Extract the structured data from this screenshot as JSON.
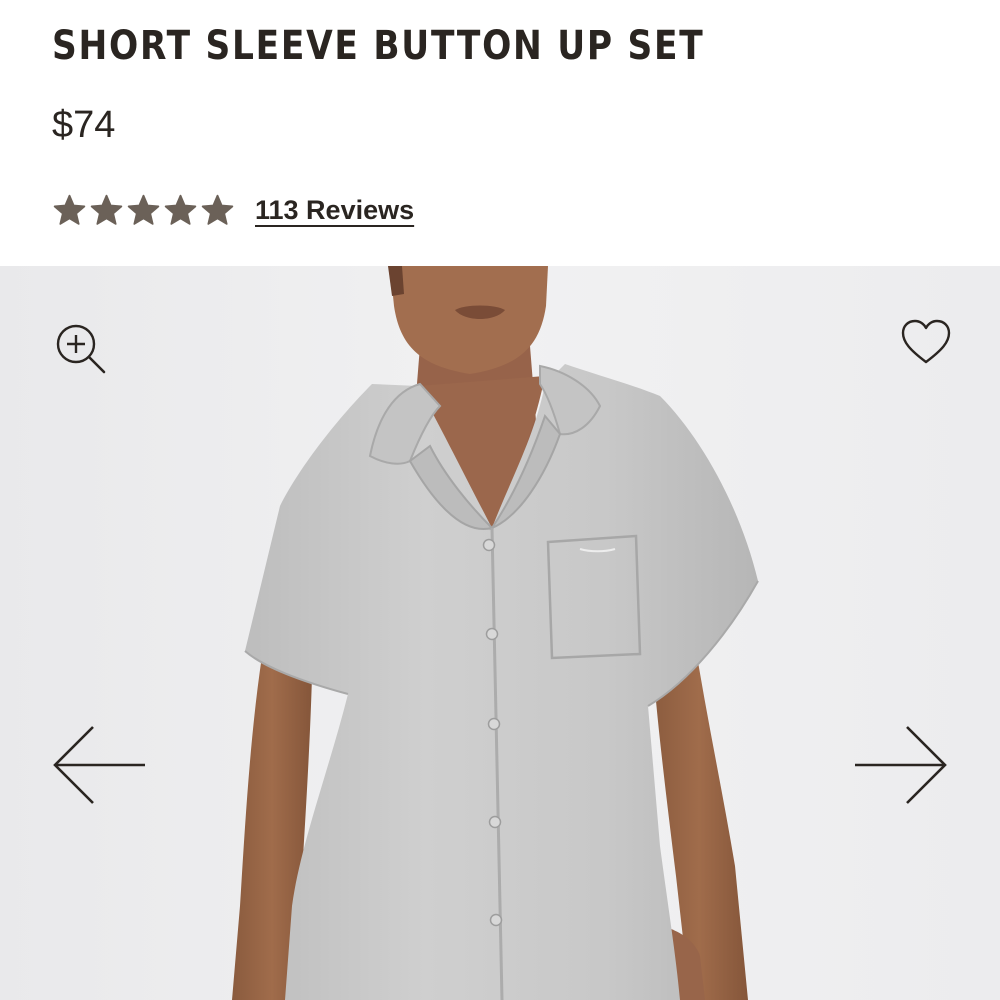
{
  "product": {
    "title": "SHORT SLEEVE BUTTON UP SET",
    "price": "$74",
    "rating": 5,
    "rating_max": 5,
    "reviews_label": "113 Reviews"
  },
  "colors": {
    "text": "#2a2521",
    "star": "#6b6158",
    "gallery_bg": "#eeeeef",
    "garment": "#c9c9c9"
  },
  "gallery": {
    "icons": {
      "zoom": "zoom-in-icon",
      "favorite": "heart-icon",
      "previous": "arrow-left-icon",
      "next": "arrow-right-icon"
    }
  }
}
